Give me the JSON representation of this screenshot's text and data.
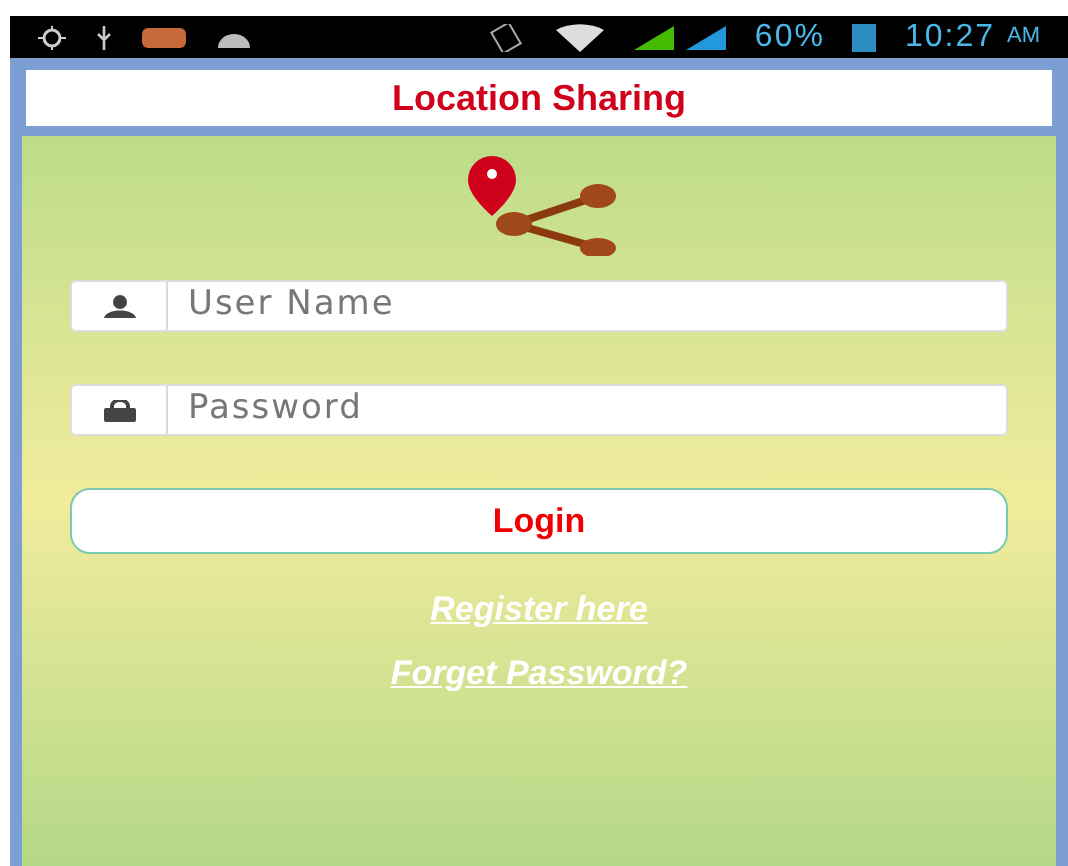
{
  "status_bar": {
    "battery": "60%",
    "time": "10:27",
    "ampm": "AM"
  },
  "title": "Location Sharing",
  "form": {
    "username": {
      "placeholder": "User Name"
    },
    "password": {
      "placeholder": "Password"
    },
    "login_button": "Login"
  },
  "links": [
    "Register here",
    "Forget Password?"
  ]
}
